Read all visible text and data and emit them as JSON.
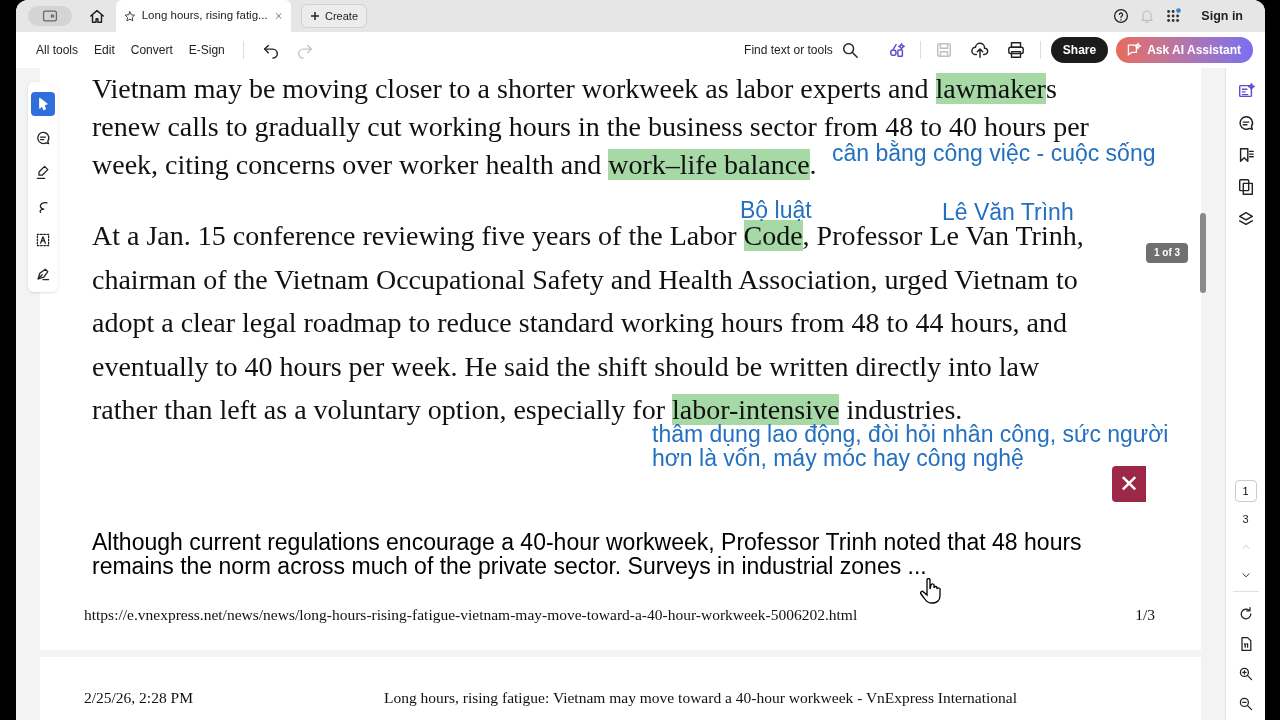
{
  "tab_bar": {
    "tabs": [
      {
        "title": "Long hours, rising fatig...",
        "selected": true
      }
    ],
    "create": "Create",
    "sign_in": "Sign in",
    "notifications_disabled": true
  },
  "toolbar": {
    "menus": [
      "All tools",
      "Edit",
      "Convert",
      "E-Sign"
    ],
    "history": [
      {
        "kind": "undo",
        "disabled": false
      },
      {
        "kind": "redo",
        "disabled": true
      }
    ],
    "find": "Find text or tools",
    "actions": [
      {
        "kind": "ai-tools",
        "disabled": false
      },
      {
        "kind": "save",
        "disabled": true
      },
      {
        "kind": "upload",
        "disabled": false
      },
      {
        "kind": "print",
        "disabled": false
      }
    ],
    "share": "Share",
    "ai_assistant": "Ask AI Assistant"
  },
  "left_tools": [
    {
      "kind": "select",
      "selected": true
    },
    {
      "kind": "comment",
      "selected": false
    },
    {
      "kind": "highlight",
      "selected": false
    },
    {
      "kind": "draw",
      "selected": false
    },
    {
      "kind": "textbox",
      "selected": false
    },
    {
      "kind": "sign",
      "selected": false
    }
  ],
  "pages": [
    {
      "paragraphs": [
        {
          "kind": "serif",
          "lines": [
            [
              {
                "text": "Vietnam may be moving closer to a shorter workweek as labor experts and ",
                "highlighted": false
              },
              {
                "text": "lawmaker",
                "highlighted": true
              },
              {
                "text": "s",
                "highlighted": false
              }
            ],
            [
              {
                "text": "renew calls to gradually cut working hours in the business sector from 48 to 40 hours per",
                "highlighted": false
              }
            ],
            [
              {
                "text": "week, citing concerns over worker health and ",
                "highlighted": false
              },
              {
                "text": "work–life balance",
                "highlighted": true
              },
              {
                "text": ".",
                "highlighted": false
              }
            ]
          ]
        },
        {
          "kind": "serif-loose",
          "lines": [
            [
              {
                "text": "At a Jan. 15 conference reviewing five years of the Labor ",
                "highlighted": false
              },
              {
                "text": "Code",
                "highlighted": true
              },
              {
                "text": ", Professor Le Van Trinh,",
                "highlighted": false
              }
            ],
            [
              {
                "text": "chairman of the Vietnam Occupational Safety and Health Association, urged Vietnam to",
                "highlighted": false
              }
            ],
            [
              {
                "text": "adopt a clear legal roadmap to reduce standard working hours from 48 to 44 hours, and",
                "highlighted": false
              }
            ],
            [
              {
                "text": "eventually to 40 hours per week. He said the shift should be written directly into law",
                "highlighted": false
              }
            ],
            [
              {
                "text": "rather than left as a voluntary option, especially for ",
                "highlighted": false
              },
              {
                "text": "labor-intensive",
                "highlighted": true
              },
              {
                "text": " industries.",
                "highlighted": false
              }
            ]
          ]
        },
        {
          "kind": "sans",
          "lines": [
            [
              {
                "text": "Although current regulations encourage a 40-hour workweek, Professor Trinh noted that 48 hours",
                "highlighted": false
              }
            ],
            [
              {
                "text": "remains the norm across much of the private sector. Surveys in industrial zones ...",
                "highlighted": false
              }
            ]
          ]
        }
      ],
      "notes": [
        {
          "lines": [
            "cân bằng công việc - cuộc sống"
          ]
        },
        {
          "lines": [
            "Bộ luật"
          ]
        },
        {
          "lines": [
            "Lê Văn Trình"
          ]
        },
        {
          "lines": [
            "thâm dụng lao động, đòi hỏi nhân công, sức người",
            "hơn là vốn, máy móc hay công nghệ"
          ]
        }
      ],
      "close_note": "✕",
      "footer": {
        "url": "https://e.vnexpress.net/news/news/long-hours-rising-fatigue-vietnam-may-move-toward-a-40-hour-workweek-5006202.html",
        "page": "1/3"
      }
    },
    {
      "header": {
        "date": "2/25/26, 2:28 PM",
        "title": "Long hours, rising fatigue: Vietnam may move toward a 40-hour workweek - VnExpress International"
      }
    }
  ],
  "page_tooltip": "1 of 3",
  "right_rail": {
    "tools": [
      {
        "kind": "ai-summary"
      },
      {
        "kind": "comments"
      },
      {
        "kind": "bookmarks"
      },
      {
        "kind": "pages"
      },
      {
        "kind": "layers"
      }
    ],
    "page_field": "1",
    "page_total": "3",
    "prev_disabled": true,
    "view_tools": [
      {
        "kind": "rotate"
      },
      {
        "kind": "fit"
      },
      {
        "kind": "zoom-in"
      },
      {
        "kind": "zoom-out"
      }
    ]
  }
}
